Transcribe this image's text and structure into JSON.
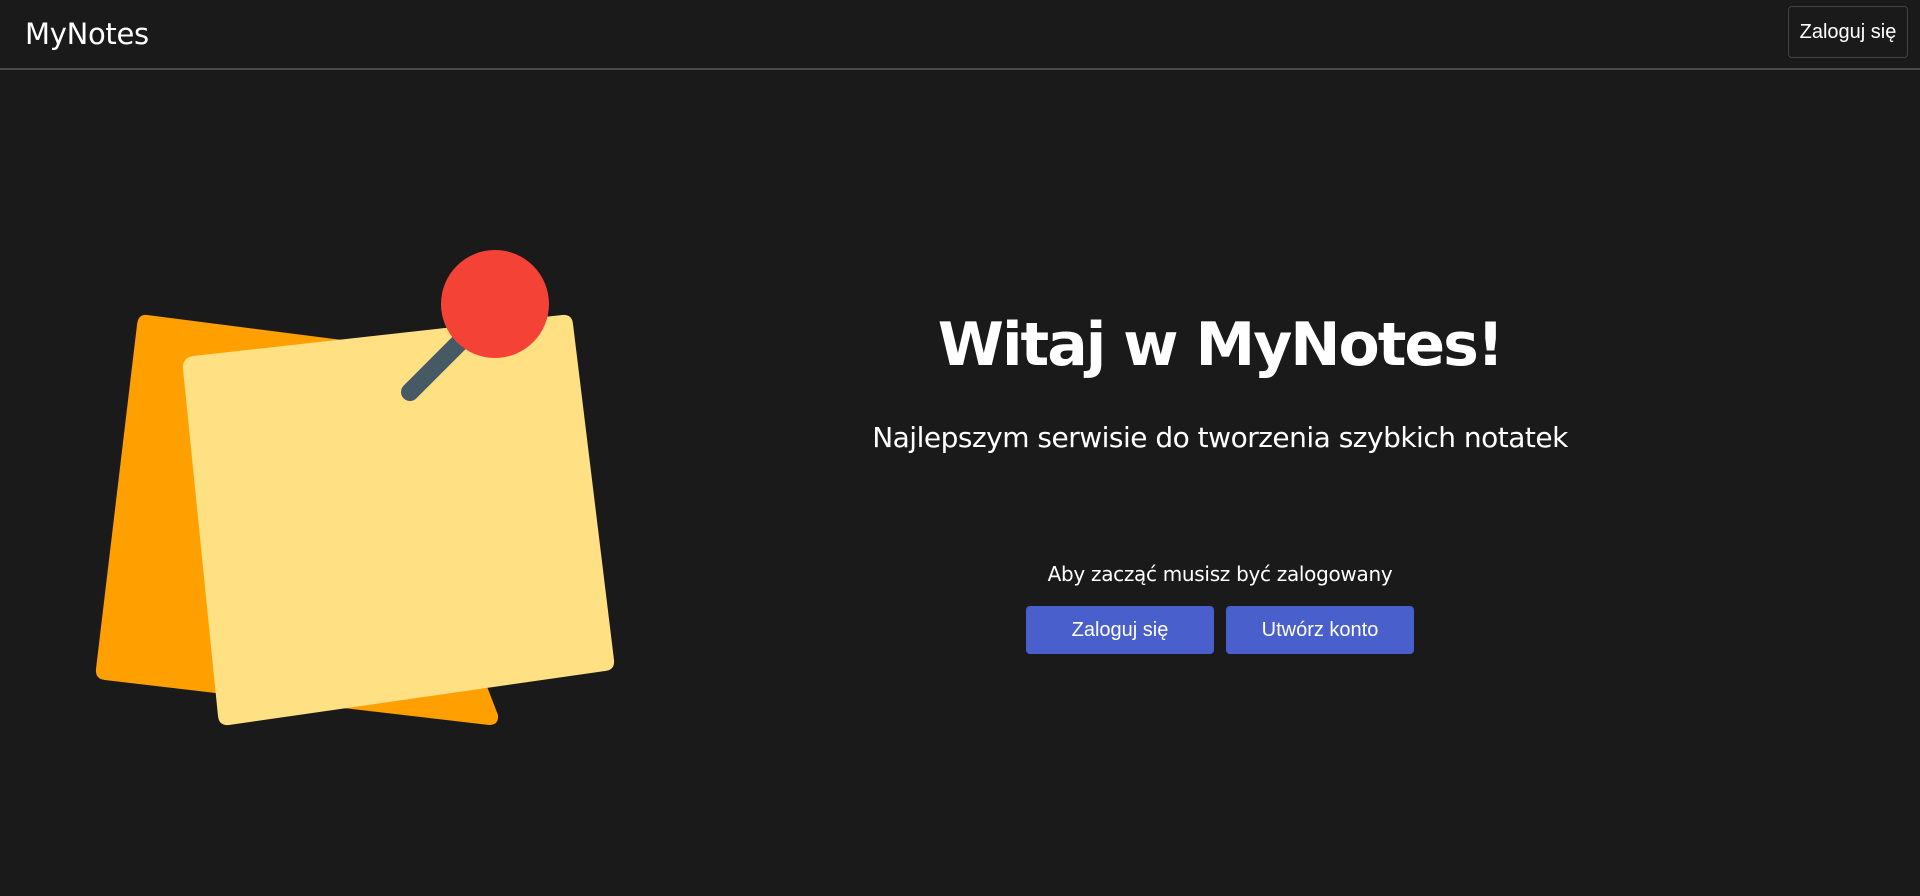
{
  "navbar": {
    "brand": "MyNotes",
    "login_label": "Zaloguj się"
  },
  "hero": {
    "title": "Witaj w MyNotes!",
    "subtitle": "Najlepszym serwisie do tworzenia szybkich notatek",
    "info": "Aby zacząć musisz być zalogowany",
    "login_label": "Zaloguj się",
    "register_label": "Utwórz konto"
  },
  "illustration": {
    "icon": "sticky-notes-pin-icon",
    "colors": {
      "back_note": "#ffa000",
      "front_note": "#ffe082",
      "pin_head": "#f44336",
      "pin_needle": "#455a64"
    }
  },
  "colors": {
    "background": "#1a1a1a",
    "accent": "#485fcc",
    "text": "#ffffff",
    "divider": "#4a4a4a"
  }
}
